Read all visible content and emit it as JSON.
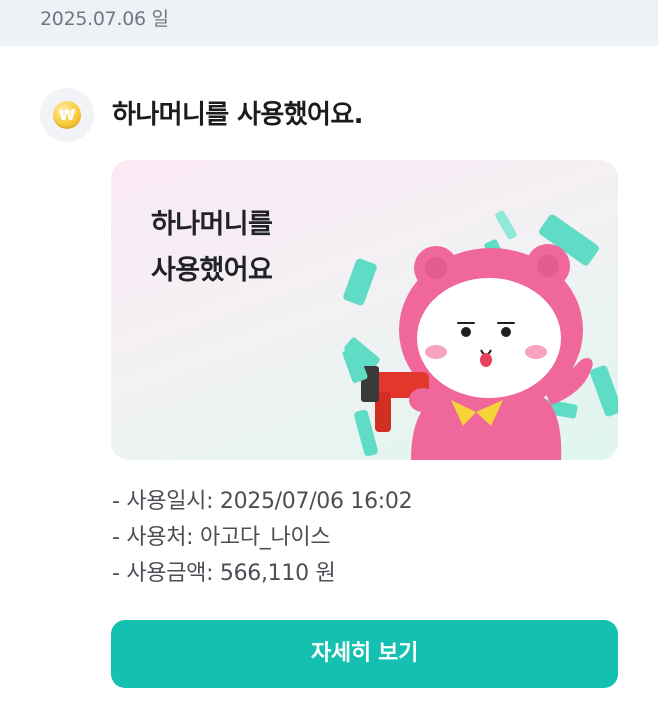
{
  "header": {
    "date": "2025.07.06 일"
  },
  "message": {
    "icon": "coin-won-icon",
    "coin_symbol": "₩",
    "title": "하나머니를 사용했어요."
  },
  "banner": {
    "line1": "하나머니를",
    "line2": "사용했어요",
    "illustration": "pink-bear-character-with-money-gun",
    "colors": {
      "character": "#f0679b",
      "money": "#5fdcc6",
      "gun": "#e2372a"
    }
  },
  "details": {
    "datetime": "- 사용일시: 2025/07/06 16:02",
    "merchant": "- 사용처: 아고다_나이스",
    "amount": "- 사용금액: 566,110 원"
  },
  "button": {
    "label": "자세히 보기",
    "color": "#14c1b0"
  }
}
